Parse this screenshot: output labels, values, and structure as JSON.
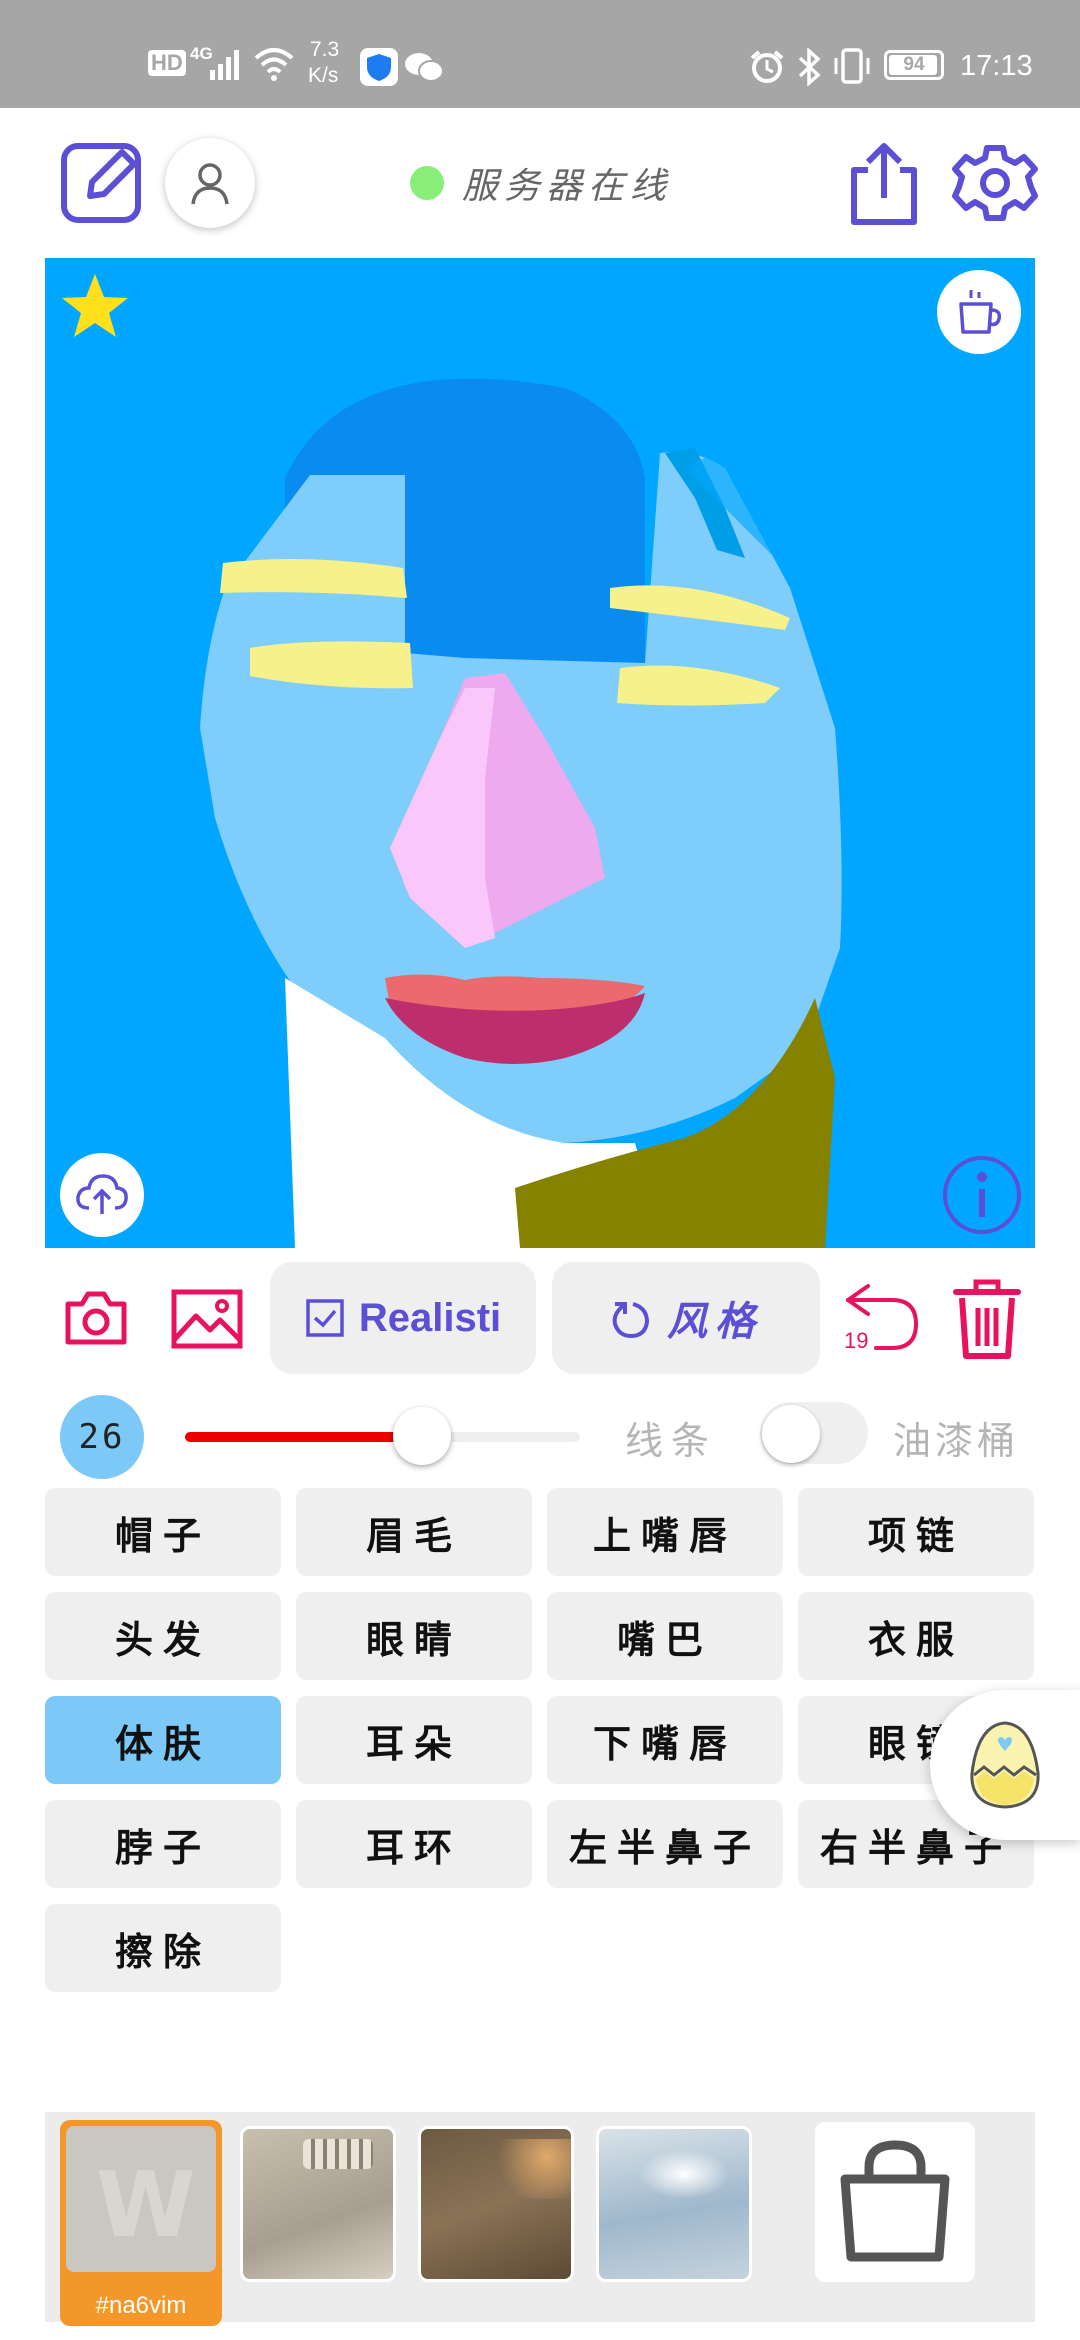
{
  "status_bar": {
    "hd": "HD",
    "network": "4G",
    "speed_value": "7.3",
    "speed_unit": "K/s",
    "battery": "94",
    "time": "17:13"
  },
  "header": {
    "server_status": "服务器在线",
    "server_status_color": "#88ee77",
    "icons": [
      "edit-icon",
      "user-icon",
      "share-icon",
      "settings-icon"
    ]
  },
  "canvas": {
    "background": "#00a6ff",
    "icons": [
      "star-icon",
      "coffee-cup-icon",
      "cloud-upload-icon",
      "info-icon"
    ]
  },
  "toolbar": {
    "model_label": "Realisti",
    "style_label": "风格",
    "undo_count": "19",
    "icons": [
      "camera-icon",
      "image-icon",
      "checkbox-icon",
      "refresh-icon",
      "undo-icon",
      "trash-icon"
    ]
  },
  "brush": {
    "size": "26",
    "slider_fraction": 0.6,
    "line_label": "线条",
    "bucket_label": "油漆桶",
    "bucket_enabled": false
  },
  "parts": {
    "selected": "体肤",
    "items": [
      "帽子",
      "眉毛",
      "上嘴唇",
      "项链",
      "头发",
      "眼睛",
      "嘴巴",
      "衣服",
      "体肤",
      "耳朵",
      "下嘴唇",
      "眼镜",
      "脖子",
      "耳环",
      "左半鼻子",
      "右半鼻子",
      "擦除"
    ]
  },
  "gallery": {
    "selected_tag": "#na6vim",
    "accent": "#f3972b",
    "icons": [
      "shopping-bag-icon",
      "egg-icon"
    ]
  }
}
